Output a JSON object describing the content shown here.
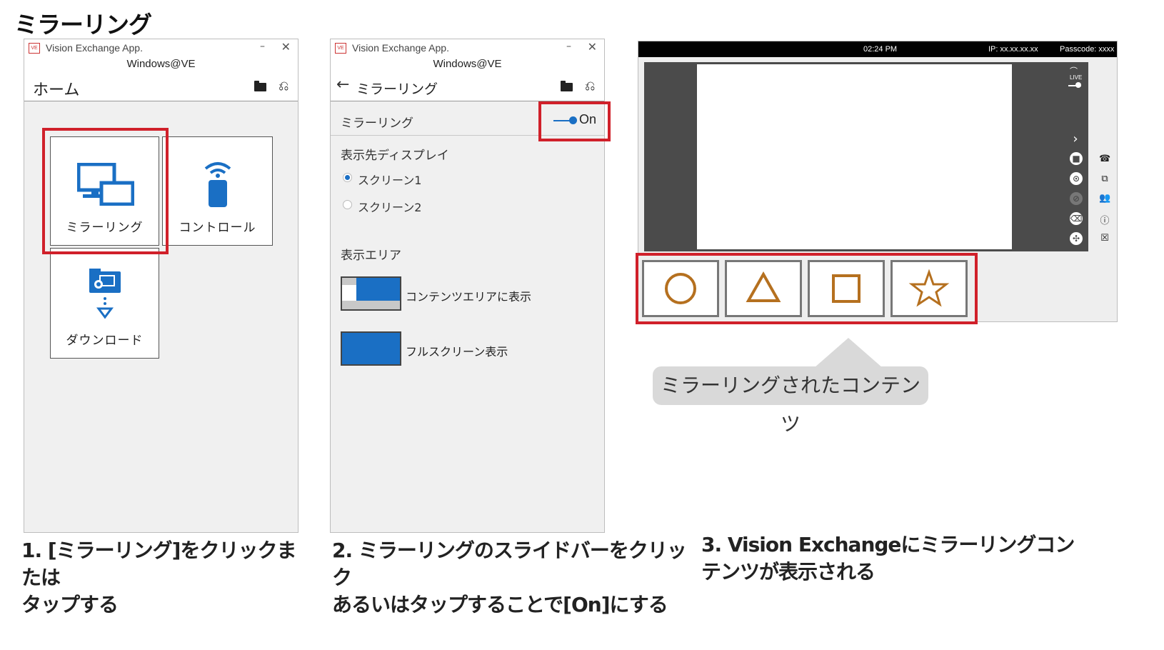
{
  "page_title": "ミラーリング",
  "app": {
    "window_title": "Vision Exchange App.",
    "logo_text": "VE",
    "minimize_glyph": "–",
    "close_glyph": "✕",
    "host": "Windows@VE"
  },
  "panel1": {
    "header_title": "ホーム",
    "tiles": [
      {
        "label": "ミラーリング"
      },
      {
        "label": "コントロール"
      },
      {
        "label": "ダウンロード"
      }
    ],
    "caption": "1. [ミラーリング]をクリックまたは\nタップする"
  },
  "panel2": {
    "back_glyph": "←",
    "header_title": "ミラーリング",
    "toggle": {
      "label": "ミラーリング",
      "state_text": "On",
      "on": true
    },
    "display_heading": "表示先ディスプレイ",
    "screens": [
      {
        "label": "スクリーン1",
        "selected": true
      },
      {
        "label": "スクリーン2",
        "selected": false
      }
    ],
    "area_heading": "表示エリア",
    "areas": [
      {
        "label": "コンテンツエリアに表示"
      },
      {
        "label": "フルスクリーン表示"
      }
    ],
    "caption": "2. ミラーリングのスライドバーをクリック\nあるいはタップすることで[On]にする"
  },
  "panel3": {
    "time": "02:24 PM",
    "ip": "IP: xx.xx.xx.xx",
    "passcode": "Passcode: xxxx",
    "live_label": "LIVE",
    "shapes": [
      "circle",
      "triangle",
      "square",
      "star"
    ],
    "shape_color": "#b5701f",
    "callout": "ミラーリングされたコンテンツ",
    "caption": "3. Vision Exchangeにミラーリングコン\nテンツが表示される"
  },
  "colors": {
    "accent": "#1a6fc4",
    "highlight": "#d0202a"
  }
}
